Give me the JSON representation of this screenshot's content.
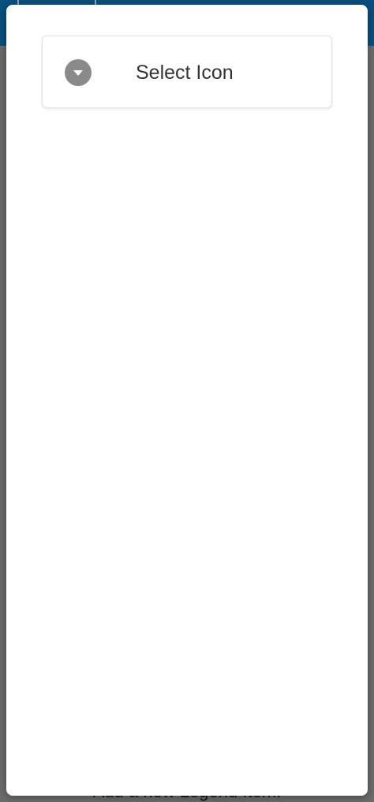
{
  "background_page": {
    "partial_text": "Add a new Legend Item!"
  },
  "modal": {
    "select": {
      "label": "Select Icon",
      "icon": "chevron-down-circle-icon"
    }
  },
  "colors": {
    "header": "#0b4f7d",
    "backdrop": "#6b6b6b",
    "modal": "#ffffff",
    "icon": "#8a8a8a",
    "text": "#333333"
  }
}
